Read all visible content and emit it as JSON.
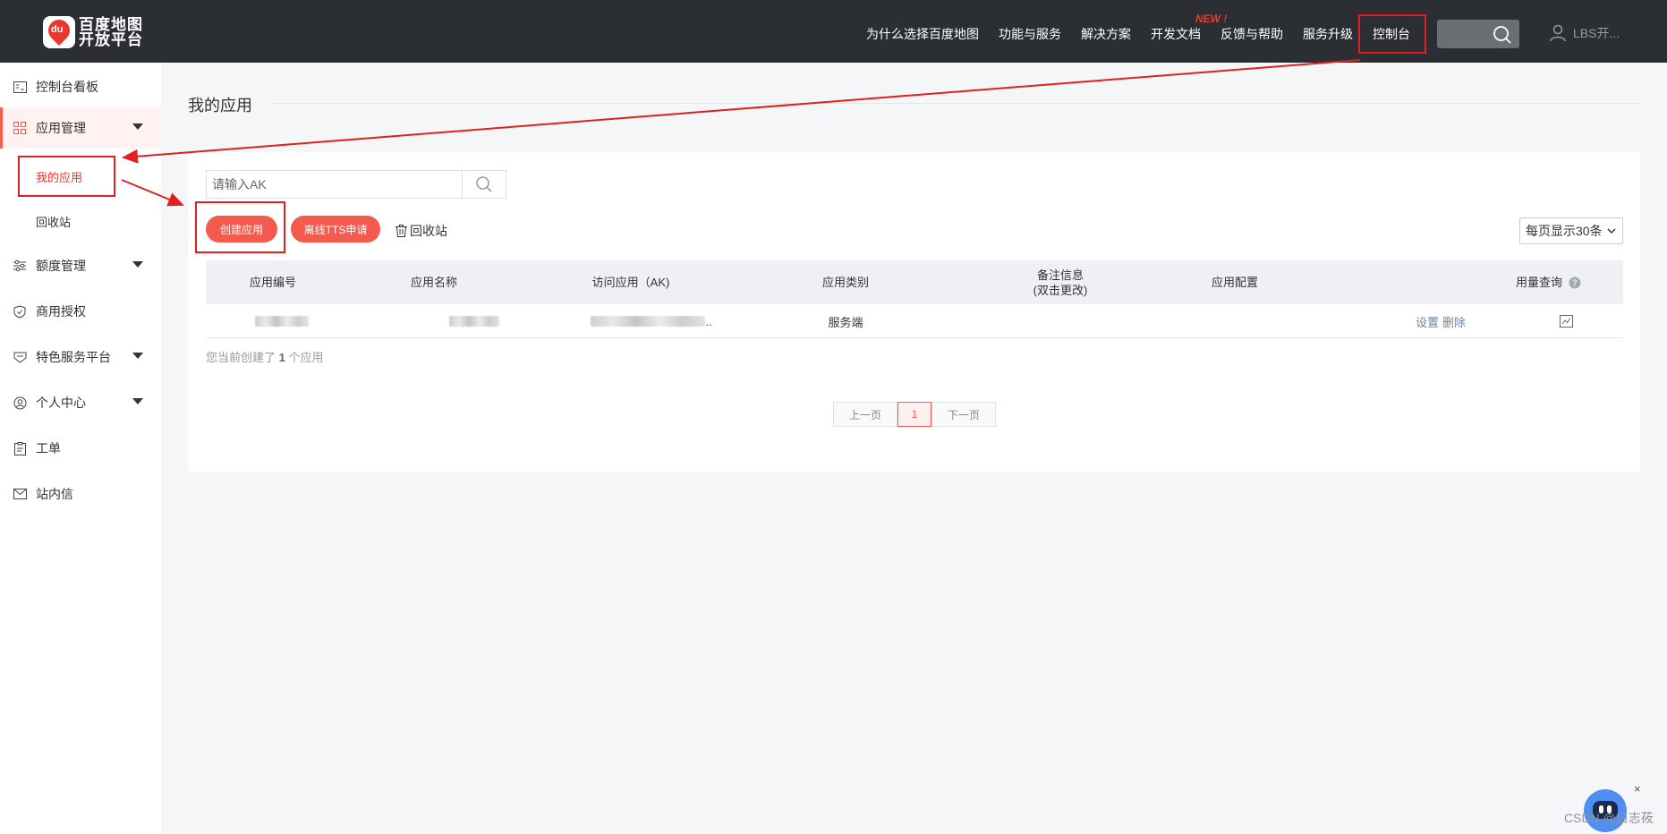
{
  "header": {
    "logo_line1": "百度地图",
    "logo_line2": "开放平台",
    "logo_badge": "du",
    "nav": [
      {
        "label": "为什么选择百度地图"
      },
      {
        "label": "功能与服务"
      },
      {
        "label": "解决方案"
      },
      {
        "label": "开发文档"
      },
      {
        "label": "反馈与帮助"
      },
      {
        "label": "服务升级"
      },
      {
        "label": "控制台"
      }
    ],
    "new_badge": "NEW !",
    "user_label": "LBS开..."
  },
  "sidebar": {
    "items": [
      {
        "label": "控制台看板",
        "icon": "dashboard-card-icon"
      },
      {
        "label": "应用管理",
        "icon": "grid-apps-icon"
      },
      {
        "label": "额度管理",
        "icon": "sliders-icon"
      },
      {
        "label": "商用授权",
        "icon": "shield-check-icon"
      },
      {
        "label": "特色服务平台",
        "icon": "badge-icon"
      },
      {
        "label": "个人中心",
        "icon": "user-circle-icon"
      },
      {
        "label": "工单",
        "icon": "clipboard-icon"
      },
      {
        "label": "站内信",
        "icon": "mail-icon"
      }
    ],
    "sub_items": [
      {
        "label": "我的应用"
      },
      {
        "label": "回收站"
      }
    ]
  },
  "main": {
    "title": "我的应用",
    "search_placeholder": "请输入AK",
    "create_button": "创建应用",
    "tts_button": "离线TTS申请",
    "recycle_link": "回收站",
    "page_size": "每页显示30条",
    "columns": [
      "应用编号",
      "应用名称",
      "访问应用（AK)",
      "应用类别",
      "备注信息",
      "(双击更改)",
      "应用配置",
      "用量查询"
    ],
    "row": {
      "category": "服务端",
      "ak_suffix": "..",
      "settings": "设置",
      "delete": "删除"
    },
    "summary_prefix": "您当前创建了",
    "summary_count": "1",
    "summary_suffix": "个应用",
    "pager": {
      "prev": "上一页",
      "current": "1",
      "next": "下一页"
    }
  },
  "widget": {
    "watermark": "CSDN @白志莜",
    "close": "×"
  },
  "colors": {
    "topbar": "#2b2e33",
    "accent": "#f55a4e",
    "annotation": "#e02020"
  }
}
